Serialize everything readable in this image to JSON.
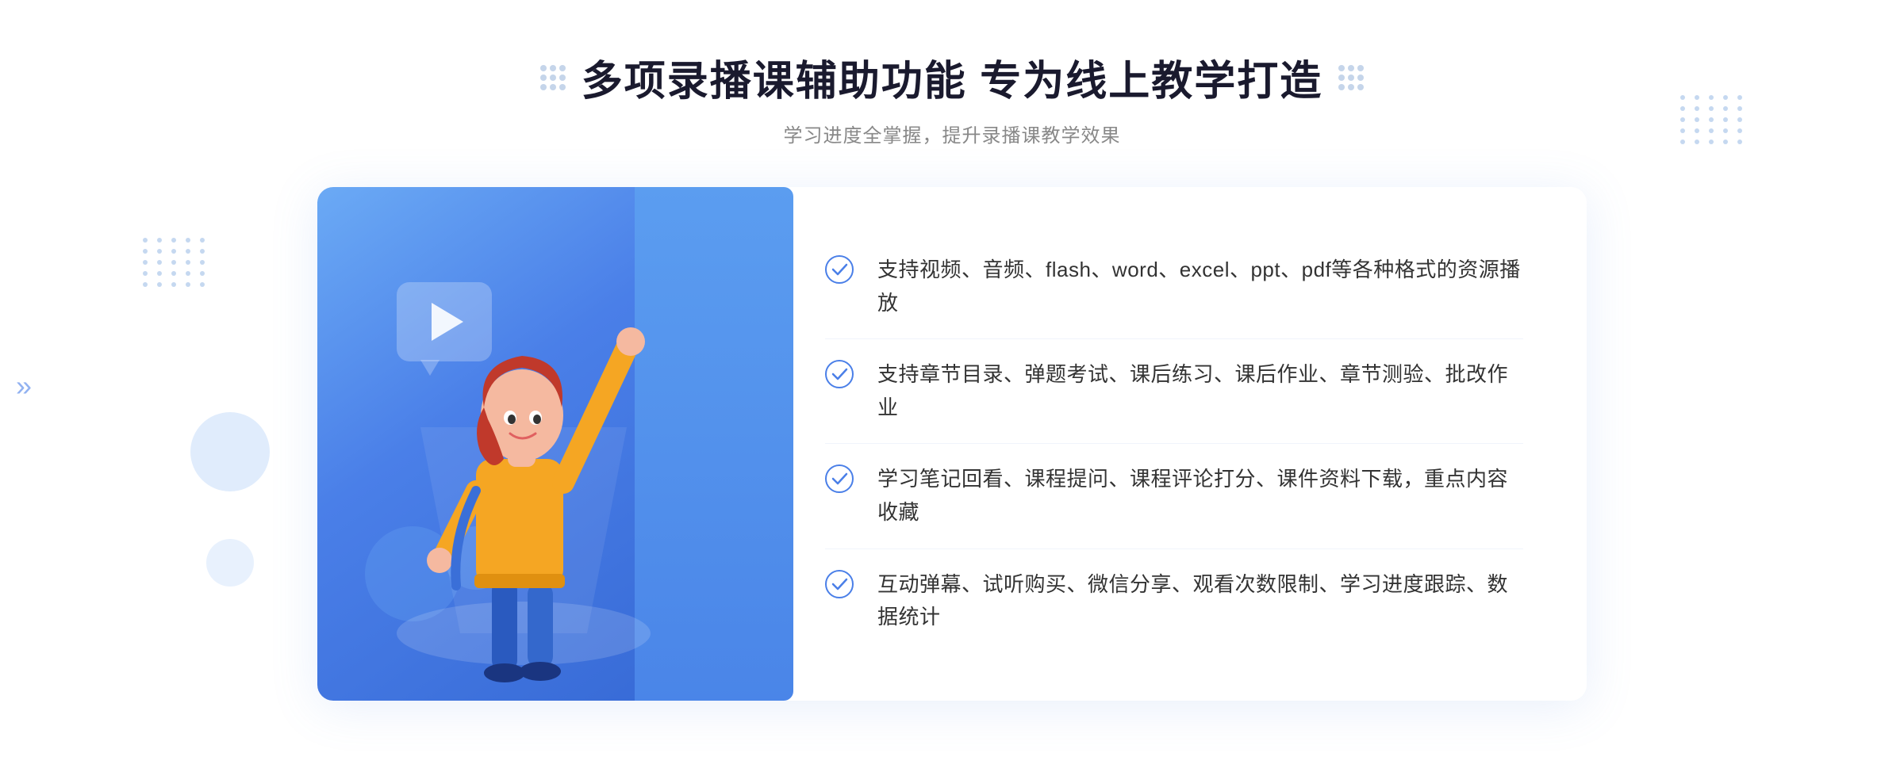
{
  "header": {
    "main_title": "多项录播课辅助功能 专为线上教学打造",
    "sub_title": "学习进度全掌握，提升录播课教学效果"
  },
  "features": [
    {
      "id": 1,
      "text": "支持视频、音频、flash、word、excel、ppt、pdf等各种格式的资源播放"
    },
    {
      "id": 2,
      "text": "支持章节目录、弹题考试、课后练习、课后作业、章节测验、批改作业"
    },
    {
      "id": 3,
      "text": "学习笔记回看、课程提问、课程评论打分、课件资料下载，重点内容收藏"
    },
    {
      "id": 4,
      "text": "互动弹幕、试听购买、微信分享、观看次数限制、学习进度跟踪、数据统计"
    }
  ],
  "colors": {
    "accent_blue": "#4a7fe8",
    "light_blue": "#6baaf5",
    "text_dark": "#333333",
    "text_gray": "#888888",
    "title_dark": "#1a1a2e"
  }
}
